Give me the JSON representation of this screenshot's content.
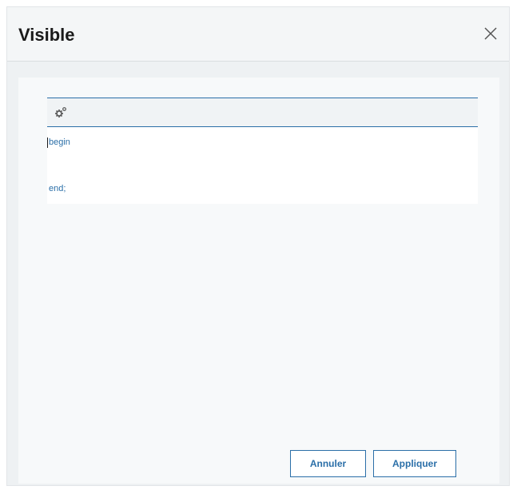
{
  "dialog": {
    "title": "Visible",
    "close_icon": "close-icon"
  },
  "editor": {
    "toolbar_icon": "gear-icon",
    "lines": [
      "begin",
      "",
      "end;"
    ],
    "text_color": "#2b6fa8"
  },
  "footer": {
    "cancel_label": "Annuler",
    "apply_label": "Appliquer"
  },
  "colors": {
    "accent": "#2b6fa8"
  }
}
